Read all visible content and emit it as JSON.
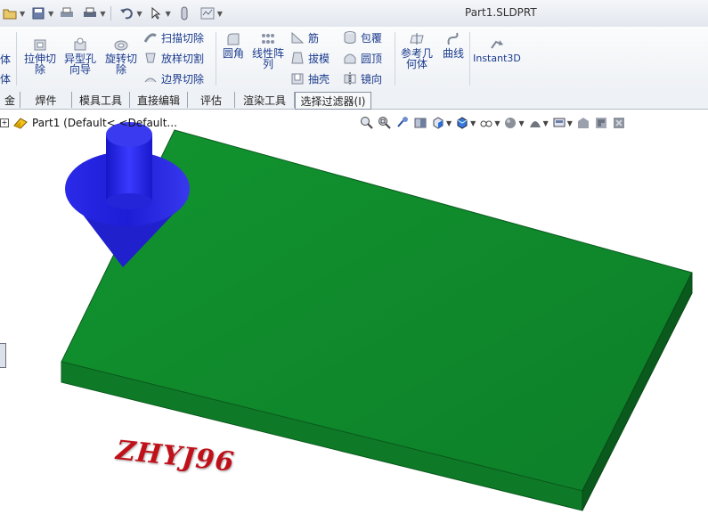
{
  "window": {
    "title": "Part1.SLDPRT"
  },
  "quick_access": {
    "icons": [
      "open-icon",
      "save-icon",
      "print-icon",
      "undo-icon",
      "select-icon",
      "rebuild-icon",
      "options-icon"
    ]
  },
  "ribbon": {
    "left_partial": [
      "体",
      "体"
    ],
    "extrude_cut": "拉伸切除",
    "hole_wizard": "异型孔向导",
    "revolve_cut": "旋转切除",
    "swept_cut": "扫描切除",
    "lofted_cut": "放样切割",
    "boundary_cut": "边界切除",
    "fillet": "圆角",
    "linear_pattern": "线性阵列",
    "rib": "筋",
    "draft": "拔模",
    "shell": "抽壳",
    "wrap": "包覆",
    "dome": "圆顶",
    "mirror": "镜向",
    "ref_geometry": "参考几何体",
    "curves": "曲线",
    "instant3d": "Instant3D"
  },
  "tabs": [
    "金",
    "焊件",
    "模具工具",
    "直接编辑",
    "评估",
    "渲染工具",
    "选择过滤器(I)"
  ],
  "feature_tree": {
    "part_label": "Part1  (Default< <Default..."
  },
  "watermark": "ZHYJ96",
  "colors": {
    "plate_top": "#0f8a2e",
    "plate_side": "#0a5a1d",
    "pin": "#2222dd"
  }
}
